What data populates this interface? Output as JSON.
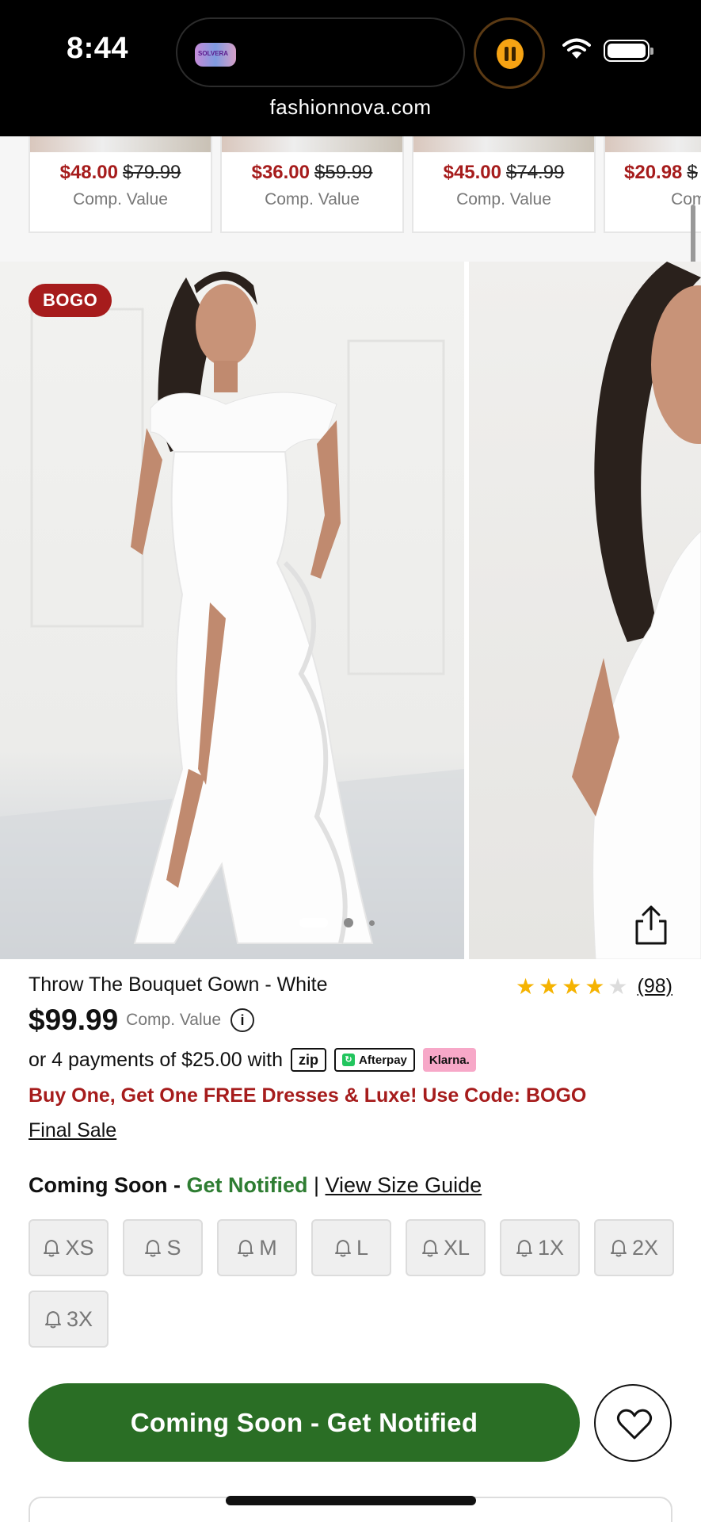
{
  "status_bar": {
    "time": "8:44",
    "url": "fashionnova.com",
    "island_thumb_text": "SOLVERA"
  },
  "recommendations": [
    {
      "sale_price": "$48.00",
      "original_price": "$79.99",
      "comp_label": "Comp. Value"
    },
    {
      "sale_price": "$36.00",
      "original_price": "$59.99",
      "comp_label": "Comp. Value"
    },
    {
      "sale_price": "$45.00",
      "original_price": "$74.99",
      "comp_label": "Comp. Value"
    },
    {
      "sale_price": "$20.98",
      "original_price": "$",
      "comp_label": "Comp."
    }
  ],
  "gallery": {
    "badge": "BOGO",
    "page_indicator": {
      "current": 1,
      "total": 3
    }
  },
  "product": {
    "title": "Throw The Bouquet Gown - White",
    "rating": 4,
    "rating_max": 5,
    "review_count": "(98)",
    "price": "$99.99",
    "comp_value_label": "Comp. Value",
    "info_icon": "i",
    "installments_text": "or 4 payments of $25.00 with",
    "pay_badges": {
      "zip": "zip",
      "afterpay": "Afterpay",
      "klarna": "Klarna."
    },
    "promo": "Buy One, Get One FREE Dresses & Luxe! Use Code: BOGO",
    "final_sale": "Final Sale",
    "coming_soon": "Coming Soon -",
    "get_notified": "Get Notified",
    "separator": "|",
    "size_guide": "View Size Guide"
  },
  "sizes": [
    "XS",
    "S",
    "M",
    "L",
    "XL",
    "1X",
    "2X",
    "3X"
  ],
  "cta": {
    "label": "Coming Soon - Get Notified"
  },
  "colors": {
    "sale_red": "#a61c1c",
    "cta_green": "#2a6e25",
    "notify_green": "#2e7d32",
    "star_gold": "#f5b301"
  }
}
